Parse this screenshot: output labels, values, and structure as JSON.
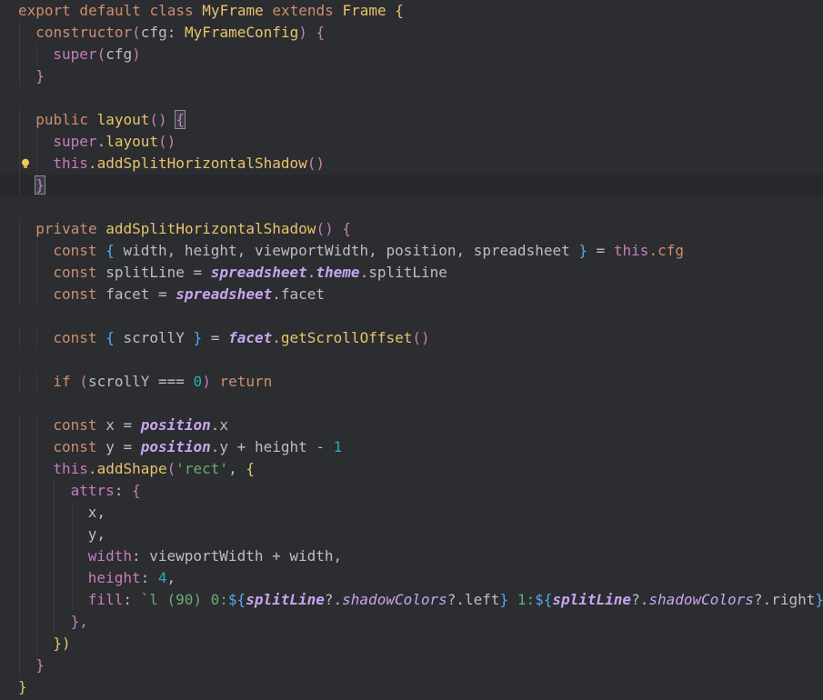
{
  "editor": {
    "language": "typescript",
    "current_line": 9,
    "intention_icon": "lightbulb-icon",
    "colors": {
      "background": "#2b2d30",
      "current_line_bg": "#26282e",
      "keyword": "#cf8e6d",
      "function": "#e8c46a",
      "string": "#6aab73",
      "number": "#2aacb8",
      "property": "#c77dbb",
      "identifier": "#bcbec4"
    },
    "lines": [
      {
        "indent": 0,
        "tokens": [
          [
            "export default class ",
            "kw"
          ],
          [
            "MyFrame",
            "cls"
          ],
          [
            " extends ",
            "kw"
          ],
          [
            "Frame",
            "type"
          ],
          [
            " {",
            "brace"
          ]
        ]
      },
      {
        "indent": 1,
        "tokens": [
          [
            "constructor",
            "kw"
          ],
          [
            "(",
            "paren"
          ],
          [
            "cfg",
            "plain"
          ],
          [
            ": ",
            "plain"
          ],
          [
            "MyFrameConfig",
            "type"
          ],
          [
            ")",
            "paren"
          ],
          [
            " {",
            "prop"
          ]
        ]
      },
      {
        "indent": 2,
        "tokens": [
          [
            "super",
            "prop"
          ],
          [
            "(",
            "paren"
          ],
          [
            "cfg",
            "plain"
          ],
          [
            ")",
            "paren"
          ]
        ]
      },
      {
        "indent": 1,
        "tokens": [
          [
            "}",
            "prop"
          ]
        ]
      },
      {
        "indent": 0,
        "tokens": []
      },
      {
        "indent": 1,
        "tokens": [
          [
            "public ",
            "kw"
          ],
          [
            "layout",
            "fnd"
          ],
          [
            "()",
            "paren"
          ],
          [
            " ",
            "plain"
          ],
          [
            "{",
            "bracehl"
          ]
        ]
      },
      {
        "indent": 2,
        "tokens": [
          [
            "super",
            "prop"
          ],
          [
            ".",
            "plain"
          ],
          [
            "layout",
            "fnd"
          ],
          [
            "()",
            "paren"
          ]
        ]
      },
      {
        "indent": 2,
        "tokens": [
          [
            "this",
            "prop"
          ],
          [
            ".",
            "plain"
          ],
          [
            "addSplitHorizontalShadow",
            "fnd"
          ],
          [
            "()",
            "paren"
          ]
        ],
        "bulb": true
      },
      {
        "indent": 1,
        "tokens": [
          [
            "}",
            "bracehl"
          ]
        ],
        "current": true
      },
      {
        "indent": 0,
        "tokens": []
      },
      {
        "indent": 1,
        "tokens": [
          [
            "private ",
            "kw"
          ],
          [
            "addSplitHorizontalShadow",
            "fnd"
          ],
          [
            "()",
            "paren"
          ],
          [
            " {",
            "prop"
          ]
        ]
      },
      {
        "indent": 2,
        "tokens": [
          [
            "const ",
            "kw"
          ],
          [
            "{ ",
            "interp"
          ],
          [
            "width, height, viewportWidth, position, spreadsheet ",
            "plain"
          ],
          [
            "}",
            "interp"
          ],
          [
            " = ",
            "plain"
          ],
          [
            "this",
            "prop"
          ],
          [
            ".cfg",
            "kw"
          ]
        ]
      },
      {
        "indent": 2,
        "tokens": [
          [
            "const ",
            "kw"
          ],
          [
            "splitLine = ",
            "plain"
          ],
          [
            "spreadsheet",
            "ivar"
          ],
          [
            ".",
            "plain"
          ],
          [
            "theme",
            "ivar"
          ],
          [
            ".splitLine",
            "plain"
          ]
        ]
      },
      {
        "indent": 2,
        "tokens": [
          [
            "const ",
            "kw"
          ],
          [
            "facet = ",
            "plain"
          ],
          [
            "spreadsheet",
            "ivar"
          ],
          [
            ".facet",
            "plain"
          ]
        ]
      },
      {
        "indent": 0,
        "tokens": []
      },
      {
        "indent": 2,
        "tokens": [
          [
            "const ",
            "kw"
          ],
          [
            "{ ",
            "interp"
          ],
          [
            "scrollY ",
            "plain"
          ],
          [
            "}",
            "interp"
          ],
          [
            " = ",
            "plain"
          ],
          [
            "facet",
            "ivar"
          ],
          [
            ".",
            "plain"
          ],
          [
            "getScrollOffset",
            "fnd"
          ],
          [
            "()",
            "paren"
          ]
        ]
      },
      {
        "indent": 0,
        "tokens": []
      },
      {
        "indent": 2,
        "tokens": [
          [
            "if ",
            "kw"
          ],
          [
            "(",
            "paren"
          ],
          [
            "scrollY ",
            "plain"
          ],
          [
            "===",
            "op"
          ],
          [
            " ",
            "plain"
          ],
          [
            "0",
            "num"
          ],
          [
            ")",
            "paren"
          ],
          [
            " return",
            "kw"
          ]
        ]
      },
      {
        "indent": 0,
        "tokens": []
      },
      {
        "indent": 2,
        "tokens": [
          [
            "const ",
            "kw"
          ],
          [
            "x = ",
            "plain"
          ],
          [
            "position",
            "ivar"
          ],
          [
            ".x",
            "plain"
          ]
        ]
      },
      {
        "indent": 2,
        "tokens": [
          [
            "const ",
            "kw"
          ],
          [
            "y = ",
            "plain"
          ],
          [
            "position",
            "ivar"
          ],
          [
            ".y + height - ",
            "plain"
          ],
          [
            "1",
            "num"
          ]
        ]
      },
      {
        "indent": 2,
        "tokens": [
          [
            "this",
            "prop"
          ],
          [
            ".",
            "plain"
          ],
          [
            "addShape",
            "fnd"
          ],
          [
            "(",
            "paren"
          ],
          [
            "'rect'",
            "str"
          ],
          [
            ", ",
            "plain"
          ],
          [
            "{",
            "brace"
          ]
        ]
      },
      {
        "indent": 3,
        "tokens": [
          [
            "attrs",
            "prop"
          ],
          [
            ": ",
            "plain"
          ],
          [
            "{",
            "prop"
          ]
        ]
      },
      {
        "indent": 4,
        "tokens": [
          [
            "x,",
            "plain"
          ]
        ]
      },
      {
        "indent": 4,
        "tokens": [
          [
            "y,",
            "plain"
          ]
        ]
      },
      {
        "indent": 4,
        "tokens": [
          [
            "width",
            "prop"
          ],
          [
            ": viewportWidth + width,",
            "plain"
          ]
        ]
      },
      {
        "indent": 4,
        "tokens": [
          [
            "height",
            "prop"
          ],
          [
            ": ",
            "plain"
          ],
          [
            "4",
            "num"
          ],
          [
            ",",
            "plain"
          ]
        ]
      },
      {
        "indent": 4,
        "tokens": [
          [
            "fill",
            "prop"
          ],
          [
            ": ",
            "plain"
          ],
          [
            "`l (90) 0:",
            "tmpl"
          ],
          [
            "${",
            "interp"
          ],
          [
            "splitLine",
            "ivar"
          ],
          [
            "?.",
            "plain"
          ],
          [
            "shadowColors",
            "shadow"
          ],
          [
            "?.",
            "plain"
          ],
          [
            "left",
            "plain"
          ],
          [
            "}",
            "interp"
          ],
          [
            " 1:",
            "tmpl"
          ],
          [
            "${",
            "interp"
          ],
          [
            "splitLine",
            "ivar"
          ],
          [
            "?.",
            "plain"
          ],
          [
            "shadowColors",
            "shadow"
          ],
          [
            "?.",
            "plain"
          ],
          [
            "right",
            "plain"
          ],
          [
            "}",
            "interp"
          ]
        ]
      },
      {
        "indent": 3,
        "tokens": [
          [
            "},",
            "prop"
          ]
        ]
      },
      {
        "indent": 2,
        "tokens": [
          [
            "})",
            "brace"
          ]
        ]
      },
      {
        "indent": 1,
        "tokens": [
          [
            "}",
            "prop"
          ]
        ]
      },
      {
        "indent": 0,
        "tokens": [
          [
            "}",
            "brace"
          ]
        ]
      }
    ]
  }
}
